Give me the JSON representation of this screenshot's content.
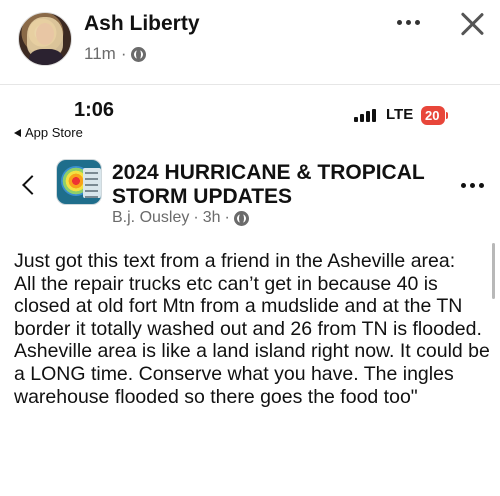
{
  "post": {
    "author": "Ash Liberty",
    "time": "11m",
    "separator": "·",
    "icons": {
      "more": "more-horizontal-icon",
      "close": "close-icon",
      "privacy": "globe-icon"
    }
  },
  "screenshot": {
    "status_bar": {
      "time": "1:06",
      "back_label": "App Store",
      "network": "LTE",
      "battery": "20"
    },
    "group": {
      "title": "2024 HURRICANE & TROPICAL STORM UPDATES",
      "author": "B.j. Ousley",
      "time": "3h",
      "separator": "·"
    },
    "body": "Just got this text from a friend in the Asheville area:\nAll the repair trucks etc can’t get in because 40 is closed at old fort Mtn from a mudslide and at the TN border it totally washed out and 26 from TN is flooded. Asheville area is like a land island right now. It could be a LONG time. Conserve what you have. The ingles warehouse flooded so there goes the food too\""
  }
}
